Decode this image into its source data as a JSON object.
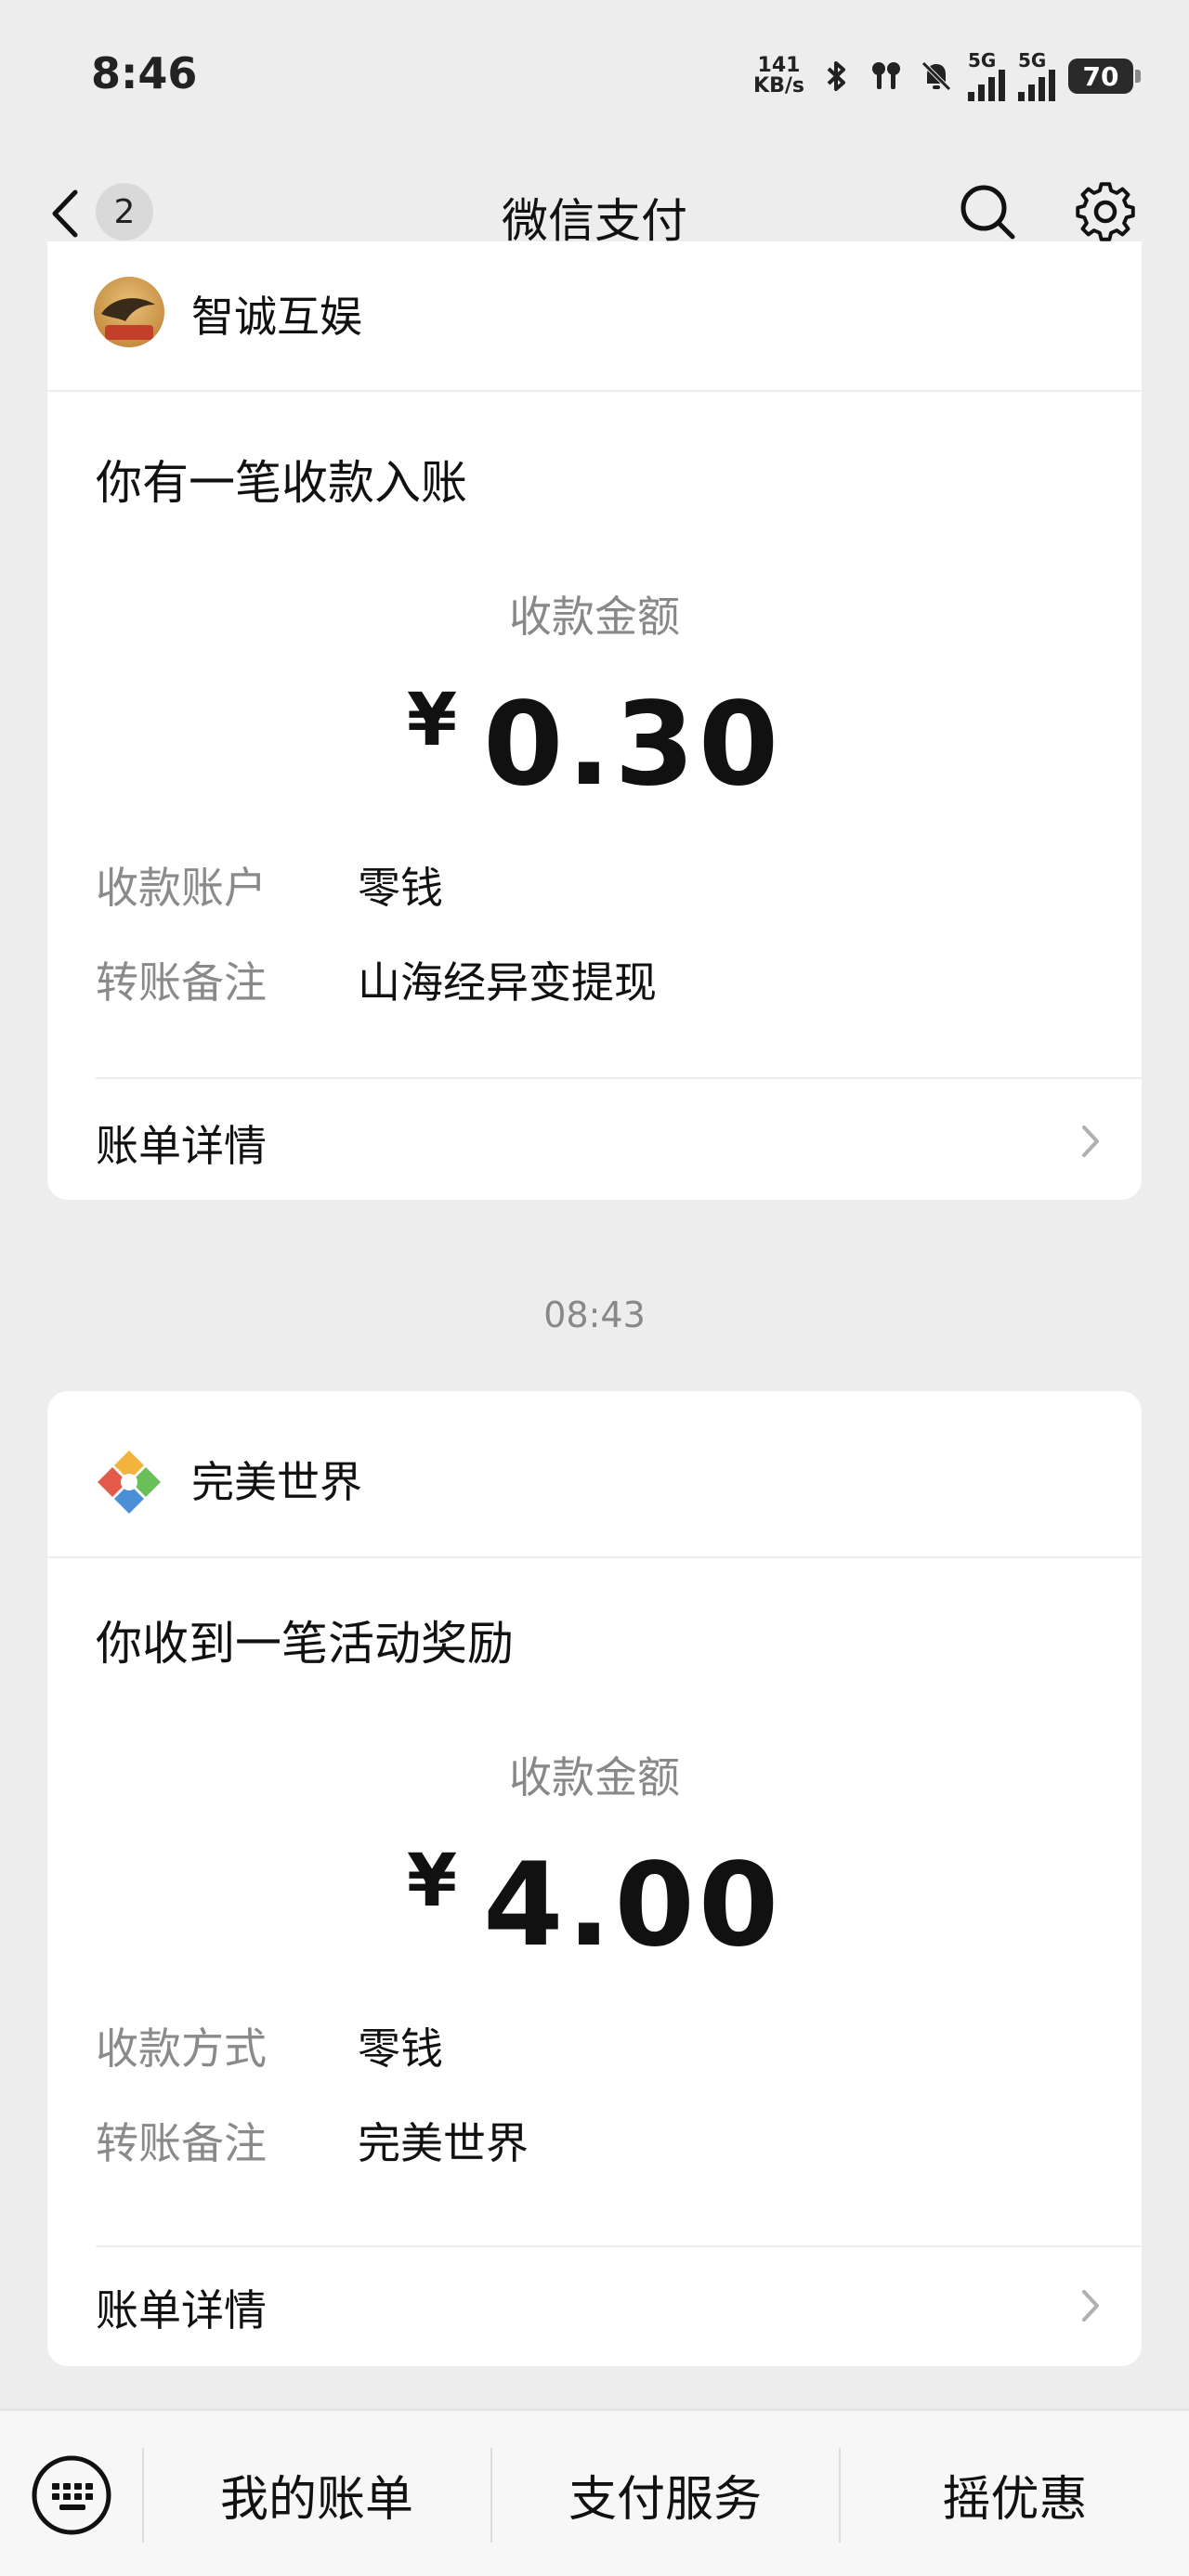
{
  "status_bar": {
    "time": "8:46",
    "net_speed_value": "141",
    "net_speed_unit": "KB/s",
    "sim1_label": "5G",
    "sim2_label": "5G",
    "battery": "70"
  },
  "nav": {
    "back_badge": "2",
    "title": "微信支付"
  },
  "cards": [
    {
      "merchant": "智诚互娱",
      "headline": "你有一笔收款入账",
      "amount_label": "收款金额",
      "currency": "¥",
      "amount": "0.30",
      "rows": [
        {
          "key": "收款账户",
          "value": "零钱"
        },
        {
          "key": "转账备注",
          "value": "山海经异变提现"
        }
      ],
      "detail_label": "账单详情"
    },
    {
      "merchant": "完美世界",
      "headline": "你收到一笔活动奖励",
      "amount_label": "收款金额",
      "currency": "¥",
      "amount": "4.00",
      "rows": [
        {
          "key": "收款方式",
          "value": "零钱"
        },
        {
          "key": "转账备注",
          "value": "完美世界"
        }
      ],
      "detail_label": "账单详情"
    }
  ],
  "timestamp": "08:43",
  "bottom_tabs": {
    "tab1": "我的账单",
    "tab2": "支付服务",
    "tab3": "摇优惠"
  },
  "icons": {
    "back": "chevron-left-icon",
    "search": "search-icon",
    "settings": "gear-icon",
    "keyboard": "keyboard-icon",
    "chevron": "chevron-right-icon"
  },
  "colors": {
    "background": "#ededed",
    "card": "#ffffff",
    "secondary_text": "#888888"
  }
}
